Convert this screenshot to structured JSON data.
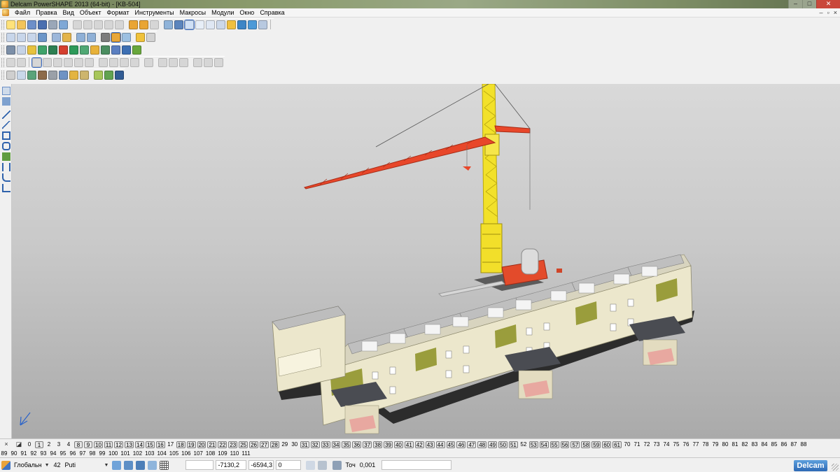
{
  "window": {
    "title": "Delcam PowerSHAPE 2013 (64-bit) - [KB-504]",
    "controls": [
      "–",
      "□",
      "✕"
    ]
  },
  "menu": {
    "items": [
      "Файл",
      "Правка",
      "Вид",
      "Объект",
      "Формат",
      "Инструменты",
      "Макросы",
      "Модули",
      "Окно",
      "Справка"
    ],
    "doc_controls": [
      "–",
      "▫",
      "×"
    ]
  },
  "layers": {
    "row1": [
      "0",
      "1",
      "2",
      "3",
      "4",
      "8",
      "9",
      "10",
      "11",
      "12",
      "13",
      "14",
      "15",
      "16",
      "17",
      "18",
      "19",
      "20",
      "21",
      "22",
      "23",
      "25",
      "26",
      "27",
      "28",
      "29",
      "30",
      "31",
      "32",
      "33",
      "34",
      "35",
      "36",
      "37",
      "38",
      "39",
      "40",
      "41",
      "42",
      "43",
      "44",
      "45",
      "46",
      "47",
      "48",
      "49",
      "50",
      "51",
      "52",
      "53",
      "54",
      "55",
      "56",
      "57",
      "58",
      "59",
      "60",
      "61",
      "70",
      "71",
      "72",
      "73",
      "74",
      "75",
      "76",
      "77",
      "78",
      "79",
      "80",
      "81",
      "82",
      "83",
      "84",
      "85",
      "86",
      "87",
      "88"
    ],
    "row2": [
      "89",
      "90",
      "91",
      "92",
      "93",
      "94",
      "95",
      "96",
      "97",
      "98",
      "99",
      "100",
      "101",
      "102",
      "103",
      "104",
      "105",
      "106",
      "107",
      "108",
      "109",
      "110",
      "111"
    ]
  },
  "status": {
    "workplane": "Глобальн",
    "level": "42",
    "named_level": "Puti",
    "x": "-7130,2",
    "y": "-6594,3",
    "z": "0",
    "tolerance_label": "Точ",
    "tolerance": "0,001",
    "brand": "Delcam"
  },
  "colors": {
    "crane_tower": "#f2e12a",
    "crane_jib": "#e8472a",
    "building_wall": "#ece7cc",
    "building_accent": "#9a9d3c",
    "roof": "#4a4c52",
    "viewport_top": "#d9d9d9",
    "viewport_bottom": "#aaaaaa"
  }
}
